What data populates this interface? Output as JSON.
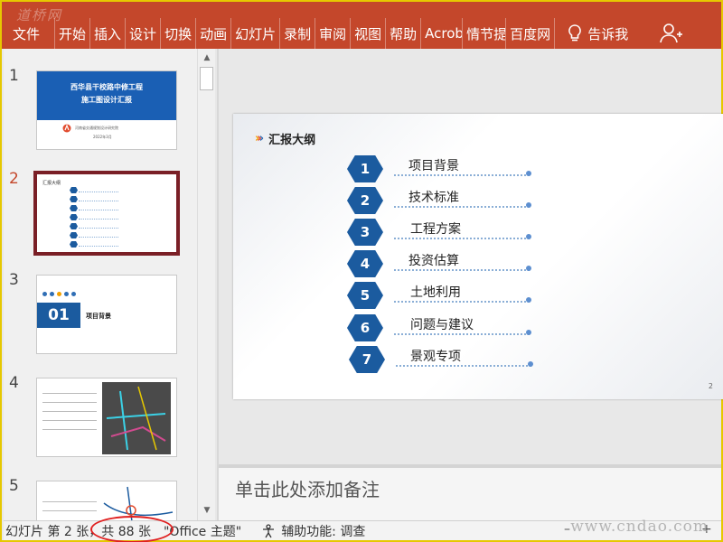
{
  "watermark": {
    "top": "道桥网",
    "bottom": "www.cndao.com"
  },
  "ribbon": {
    "tabs": [
      {
        "id": "file",
        "label": "文件"
      },
      {
        "id": "home",
        "label": "开始"
      },
      {
        "id": "insert",
        "label": "插入"
      },
      {
        "id": "design",
        "label": "设计"
      },
      {
        "id": "transitions",
        "label": "切换"
      },
      {
        "id": "animations",
        "label": "动画"
      },
      {
        "id": "slideshow",
        "label": "幻灯片"
      },
      {
        "id": "record",
        "label": "录制"
      },
      {
        "id": "review",
        "label": "审阅"
      },
      {
        "id": "view",
        "label": "视图"
      },
      {
        "id": "help",
        "label": "帮助"
      },
      {
        "id": "acrobat",
        "label": "Acrob"
      },
      {
        "id": "intel",
        "label": "情节提"
      },
      {
        "id": "baidu",
        "label": "百度网"
      }
    ],
    "tell_me": "告诉我",
    "bulb_icon": "lightbulb-icon",
    "user_icon": "user-icon",
    "color": "#c4472b"
  },
  "thumbnails": [
    {
      "number": "1",
      "title_line1": "西华县干校路中修工程",
      "title_line2": "施工图设计汇报",
      "org": "河南省交通规划设计研究院",
      "date": "2022年3月"
    },
    {
      "number": "2",
      "selected": true,
      "heading": "汇报大纲"
    },
    {
      "number": "3",
      "section_no": "01",
      "section_title": "项目背景"
    },
    {
      "number": "4"
    },
    {
      "number": "5"
    }
  ],
  "slide": {
    "title": "汇报大纲",
    "items": [
      {
        "number": "1",
        "label": "项目背景"
      },
      {
        "number": "2",
        "label": "技术标准"
      },
      {
        "number": "3",
        "label": "工程方案"
      },
      {
        "number": "4",
        "label": "投资估算"
      },
      {
        "number": "5",
        "label": "土地利用"
      },
      {
        "number": "6",
        "label": "问题与建议"
      },
      {
        "number": "7",
        "label": "景观专项"
      }
    ],
    "page_number": "2",
    "accent": "#1b5b9f"
  },
  "notes": {
    "placeholder": "单击此处添加备注"
  },
  "statusbar": {
    "slide_position": "幻灯片 第 2 张，共 88 张",
    "theme": "\"Office 主题\"",
    "accessibility": "辅助功能: 调查",
    "highlight_color": "#e02020"
  }
}
